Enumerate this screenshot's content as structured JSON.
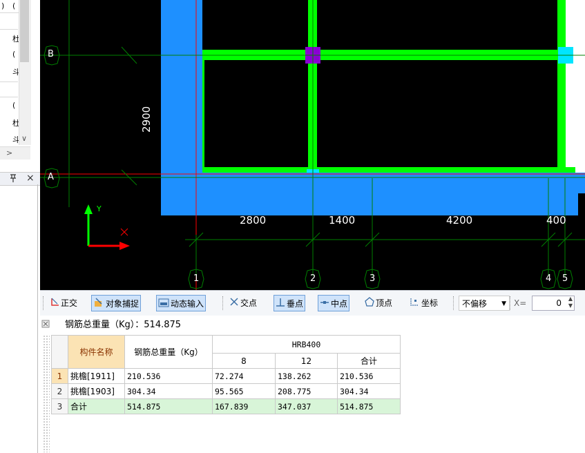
{
  "left_panel": {
    "top_cells": [
      ")",
      "("
    ],
    "list_chars": [
      "杜",
      "(",
      "斗",
      "(",
      "杜",
      "斗"
    ],
    "scroll_down_arrow": "∨",
    "scroll_right_arrow": ">",
    "pin_icon": "pin-icon",
    "close_label": "×"
  },
  "cad": {
    "axis_labels": {
      "b": "B",
      "a": "A"
    },
    "col_labels": [
      "1",
      "2",
      "3",
      "4",
      "5"
    ],
    "dimension_vertical": "2900",
    "dimensions": [
      "2800",
      "1400",
      "4200",
      "400"
    ],
    "ucs_y": "Y",
    "colors": {
      "slab": "#1e90ff",
      "beam": "#00ff00",
      "grid": "#008000",
      "axis_red": "#ff0000",
      "column": "#8a00d4",
      "cyan": "#00e5ff"
    }
  },
  "toolbar": {
    "ortho_label": "正交",
    "snap_label": "对象捕捉",
    "dynamic_input_label": "动态输入",
    "intersection_label": "交点",
    "perpendicular_label": "垂点",
    "midpoint_label": "中点",
    "vertex_label": "顶点",
    "coordinate_label": "坐标",
    "offset_value": "不偏移",
    "x_label": "X=",
    "x_value": "0"
  },
  "report": {
    "total_text": "钢筋总重量（Kg）：514.875",
    "headers": {
      "name": "构件名称",
      "total_weight": "钢筋总重量（Kg）",
      "grade": "HRB400",
      "d8": "8",
      "d12": "12",
      "subtotal": "合计"
    },
    "rows": [
      {
        "num": "1",
        "name": "挑檐[1911]",
        "total": "210.536",
        "d8": "72.274",
        "d12": "138.262",
        "sum": "210.536"
      },
      {
        "num": "2",
        "name": "挑檐[1903]",
        "total": "304.34",
        "d8": "95.565",
        "d12": "208.775",
        "sum": "304.34"
      },
      {
        "num": "3",
        "name": "合计",
        "total": "514.875",
        "d8": "167.839",
        "d12": "347.037",
        "sum": "514.875"
      }
    ]
  }
}
